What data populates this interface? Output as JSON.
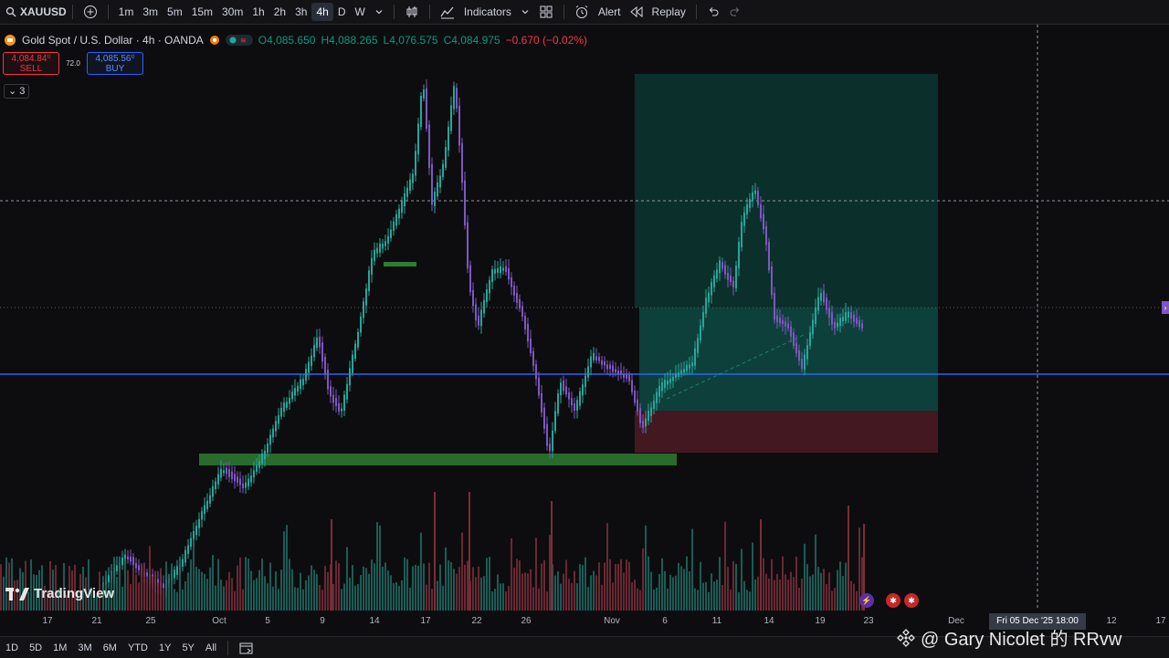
{
  "toolbar": {
    "symbol": "XAUUSD",
    "intervals": [
      "1m",
      "3m",
      "5m",
      "15m",
      "30m",
      "1h",
      "2h",
      "3h",
      "4h",
      "D",
      "W"
    ],
    "active_interval": "4h",
    "indicators_label": "Indicators",
    "alert_label": "Alert",
    "replay_label": "Replay"
  },
  "legend": {
    "title": "Gold Spot / U.S. Dollar · 4h · OANDA",
    "open": "O4,085.650",
    "high": "H4,088.265",
    "low": "L4,076.575",
    "close": "C4,084.975",
    "change": "−0.670 (−0.02%)"
  },
  "trade": {
    "sell_price": "4,084.84⁰",
    "sell_label": "SELL",
    "spread": "72.0",
    "buy_price": "4,085.56⁰",
    "buy_label": "BUY"
  },
  "indicator_count": "3",
  "logo_text": "TradingView",
  "xaxis": {
    "labels": [
      "17",
      "21",
      "25",
      "Oct",
      "5",
      "9",
      "14",
      "17",
      "22",
      "26",
      "Nov",
      "6",
      "11",
      "14",
      "19",
      "23",
      "Dec",
      "12",
      "17"
    ],
    "crosshair_label": "Fri 05 Dec '25   18:00"
  },
  "bottom_ranges": [
    "1D",
    "5D",
    "1M",
    "3M",
    "6M",
    "YTD",
    "1Y",
    "5Y",
    "All"
  ],
  "watermark": "@ Gary Nicolet 的 RRvw",
  "colors": {
    "bull": "#26a69a",
    "bear": "#7e57c2",
    "hline": "#2962ff",
    "target_zone": "#0b4d44",
    "stop_zone": "#4a1a24",
    "support_zone": "#2e7d32"
  }
}
